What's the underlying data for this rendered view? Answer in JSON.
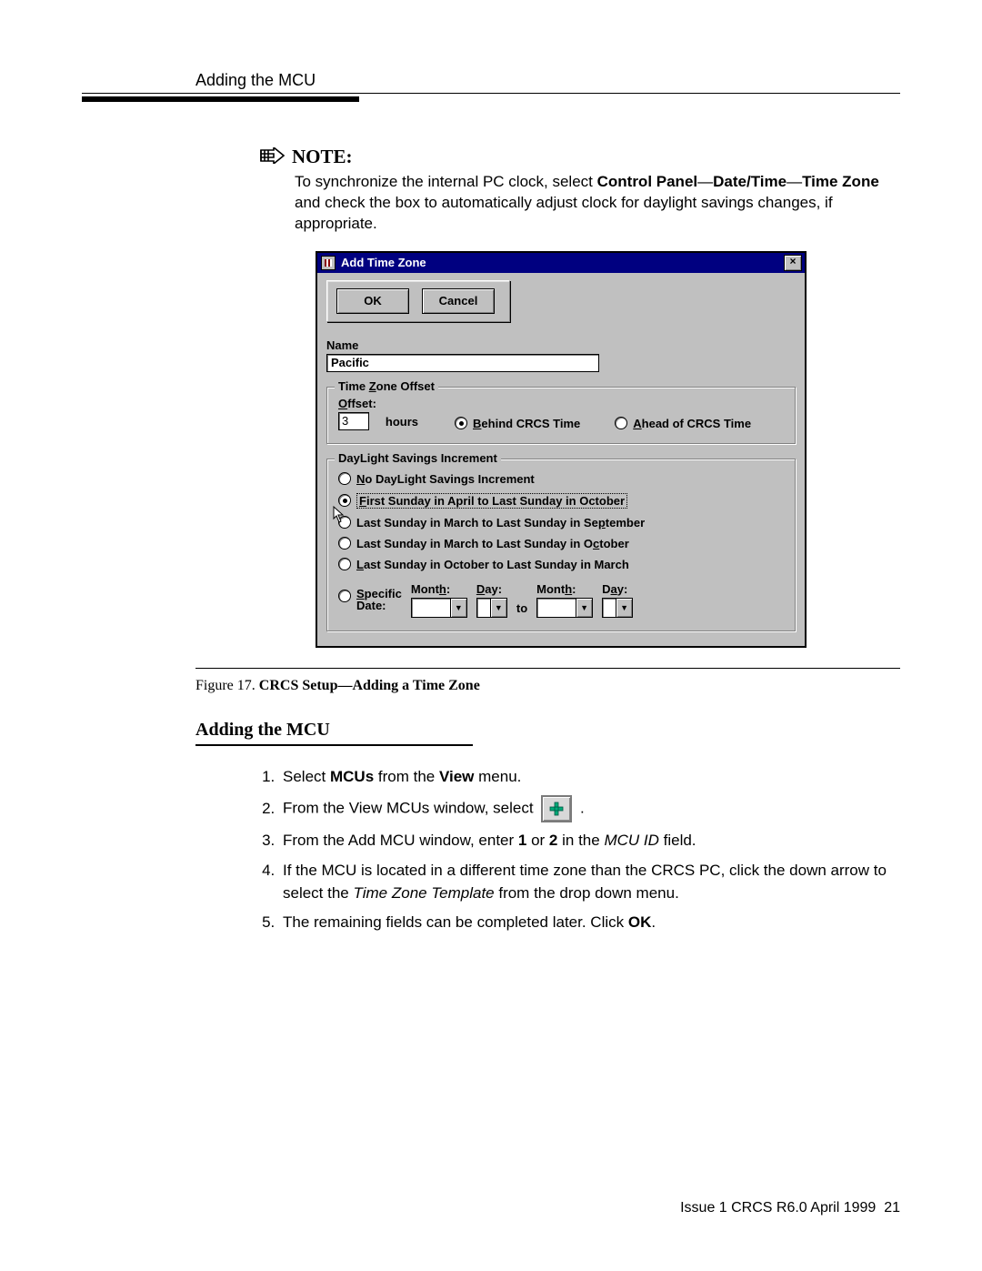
{
  "header": {
    "running": "Adding the MCU"
  },
  "note": {
    "label": "NOTE:",
    "body_pre": "To synchronize the internal PC clock, select ",
    "bold1": "Control Panel",
    "sep": "—",
    "bold2": "Date/Time",
    "bold3": "Time Zone",
    "body_post": " and check the box to automatically adjust clock for daylight savings changes, if appropriate."
  },
  "dialog": {
    "title": "Add Time Zone",
    "close": "×",
    "ok": "OK",
    "cancel": "Cancel",
    "name_label": "Name",
    "name_value": "Pacific",
    "tz_legend": "Time Zone Offset",
    "offset_label": "Offset:",
    "offset_value": "3",
    "hours": "hours",
    "behind": "Behind CRCS Time",
    "ahead": "Ahead of CRCS Time",
    "dls_legend": "DayLight Savings Increment",
    "opt_none": "No DayLight Savings Increment",
    "opt_apr_oct": "First Sunday in April to Last Sunday in October",
    "opt_mar_sep": "Last Sunday in March to Last Sunday in September",
    "opt_mar_oct": "Last Sunday in March to Last Sunday in October",
    "opt_oct_mar": "Last Sunday in October to Last Sunday in March",
    "opt_specific": "Specific Date:",
    "month_label": "Month:",
    "day_label": "Day:",
    "to": "to"
  },
  "figure": {
    "num": "Figure 17. ",
    "title": "CRCS Setup—Adding a Time Zone"
  },
  "section": {
    "title": "Adding the MCU"
  },
  "steps": {
    "s1_a": "Select ",
    "s1_b": "MCUs",
    "s1_c": " from the ",
    "s1_d": "View",
    "s1_e": " menu.",
    "s2_a": "From the View MCUs window, select ",
    "s2_b": ".",
    "s3_a": "From the Add MCU window, enter ",
    "s3_b": "1",
    "s3_c": " or ",
    "s3_d": "2",
    "s3_e": " in the ",
    "s3_f": "MCU ID",
    "s3_g": " field.",
    "s4_a": "If the MCU is located in a different time zone than the CRCS PC, click the down arrow to select the ",
    "s4_b": "Time Zone Template",
    "s4_c": " from the drop down menu.",
    "s5_a": "The remaining fields can be completed later. Click ",
    "s5_b": "OK",
    "s5_c": "."
  },
  "footer": {
    "left": "Issue 1 CRCS R6.0  April 1999",
    "page": "21"
  }
}
